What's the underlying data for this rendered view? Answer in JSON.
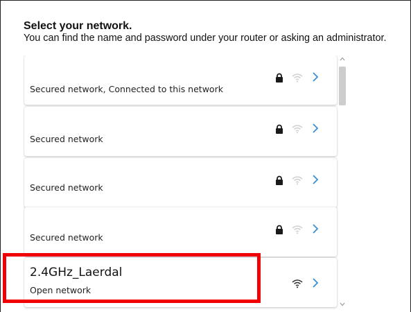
{
  "header": {
    "title": "Select your network.",
    "subtitle": "You can find the name and password under your router or asking an administrator."
  },
  "networks": [
    {
      "name": "",
      "status": "Secured network, Connected to this network",
      "secured": true,
      "icons": [
        "lock-icon",
        "wifi-icon",
        "chevron-right-icon"
      ]
    },
    {
      "name": "",
      "status": "Secured network",
      "secured": true,
      "icons": [
        "lock-icon",
        "wifi-icon",
        "chevron-right-icon"
      ]
    },
    {
      "name": "",
      "status": "Secured network",
      "secured": true,
      "icons": [
        "lock-icon",
        "wifi-icon",
        "chevron-right-icon"
      ]
    },
    {
      "name": "",
      "status": "Secured network",
      "secured": true,
      "icons": [
        "lock-icon",
        "wifi-icon",
        "chevron-right-icon"
      ]
    },
    {
      "name": "2.4GHz_Laerdal",
      "status": "Open network",
      "secured": false,
      "icons": [
        "wifi-icon",
        "chevron-right-icon"
      ]
    }
  ],
  "colors": {
    "chevron": "#3a8fd4",
    "wifi_dim": "#cfcfcf",
    "wifi_strong": "#333333",
    "lock": "#1a1a1a",
    "highlight": "#f00000"
  }
}
